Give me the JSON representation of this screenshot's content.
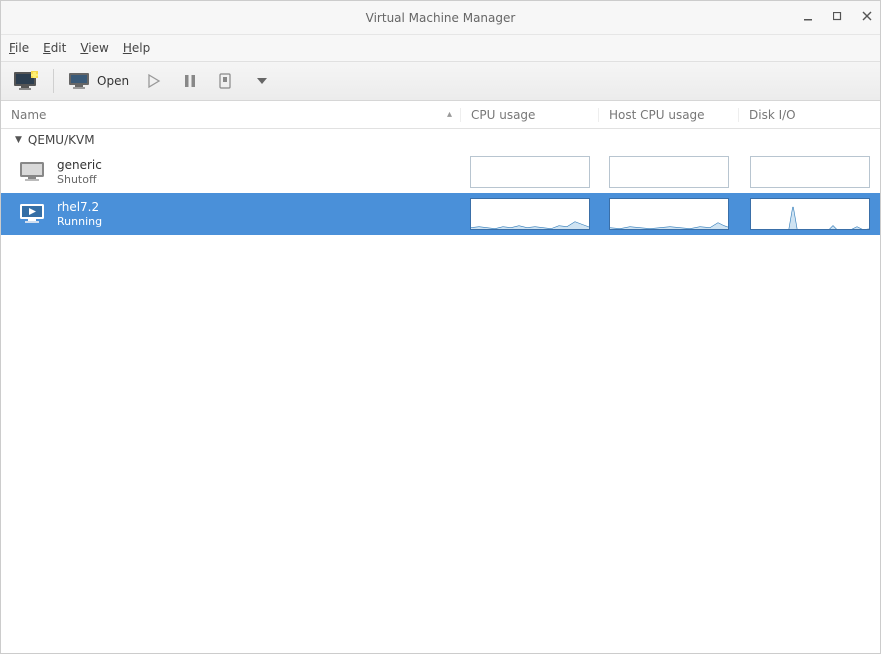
{
  "window": {
    "title": "Virtual Machine Manager"
  },
  "menu": {
    "file": "File",
    "edit": "Edit",
    "view": "View",
    "help": "Help"
  },
  "toolbar": {
    "open_label": "Open"
  },
  "columns": {
    "name": "Name",
    "cpu_usage": "CPU usage",
    "host_cpu_usage": "Host CPU usage",
    "disk_io": "Disk I/O"
  },
  "connection_group": {
    "label": "QEMU/KVM"
  },
  "vms": [
    {
      "name": "generic",
      "status": "Shutoff",
      "selected": false,
      "running": false
    },
    {
      "name": "rhel7.2",
      "status": "Running",
      "selected": true,
      "running": true
    }
  ]
}
